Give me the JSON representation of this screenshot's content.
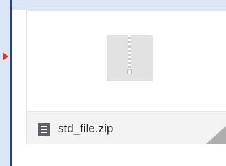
{
  "attachment": {
    "file_name": "std_file.zip",
    "preview_icon": "zip-archive-icon",
    "file_type_icon": "document-icon"
  },
  "colors": {
    "frame_background": "#dbe6f6",
    "frame_border": "#2c3f7c",
    "arrow": "#d9372b",
    "card_border": "#e3e3e3",
    "footer_background": "#f3f3f3",
    "thumbnail": "#e2e2e2",
    "icon": "#5f6368",
    "text": "#2b2b2b"
  }
}
